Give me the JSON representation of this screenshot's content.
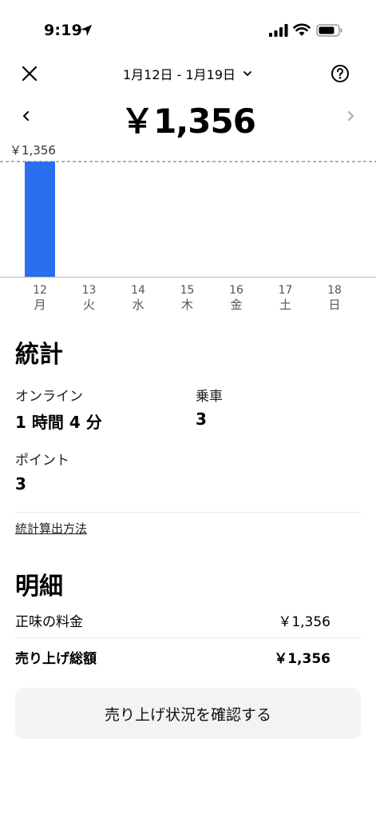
{
  "status_bar": {
    "time": "9:19"
  },
  "header": {
    "date_range": "1月12日 - 1月19日",
    "total": "￥1,356"
  },
  "chart_data": {
    "type": "bar",
    "categories": [
      "12",
      "13",
      "14",
      "15",
      "16",
      "17",
      "18"
    ],
    "weekdays": [
      "月",
      "火",
      "水",
      "木",
      "金",
      "土",
      "日"
    ],
    "values": [
      1356,
      0,
      0,
      0,
      0,
      0,
      0
    ],
    "max_label": "￥1,356",
    "ylim": [
      0,
      1356
    ],
    "bar_color": "#2b6ff0"
  },
  "stats": {
    "title": "統計",
    "online_label": "オンライン",
    "online_value": "1 時間 4 分",
    "rides_label": "乗車",
    "rides_value": "3",
    "points_label": "ポイント",
    "points_value": "3",
    "method_link": "統計算出方法"
  },
  "details": {
    "title": "明細",
    "net_fare_label": "正味の料金",
    "net_fare_value": "￥1,356",
    "total_label": "売り上げ総額",
    "total_value": "￥1,356"
  },
  "cta": {
    "label": "売り上げ状況を確認する"
  },
  "colors": {
    "accent": "#2b6ff0",
    "button_bg": "#f3f3f3"
  }
}
